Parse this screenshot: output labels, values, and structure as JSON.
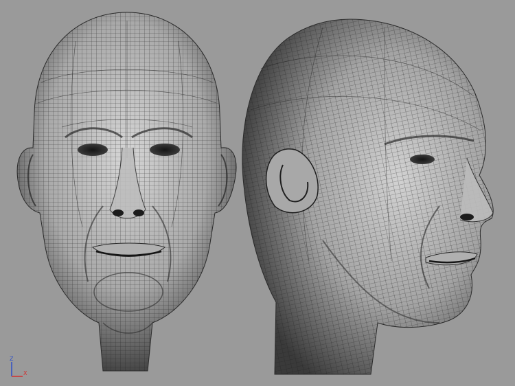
{
  "viewport": {
    "background": "#9a9a9a",
    "wire_color": "#1e1e1e",
    "shade_light": "#d6d6d6",
    "shade_dark": "#3e3e3e"
  },
  "axis_gizmo": {
    "icon": "axis-tripod-icon",
    "vertical_label": "Z",
    "horizontal_label": "X",
    "vertical_color": "#2d4ec9",
    "horizontal_color": "#d22e2e"
  }
}
